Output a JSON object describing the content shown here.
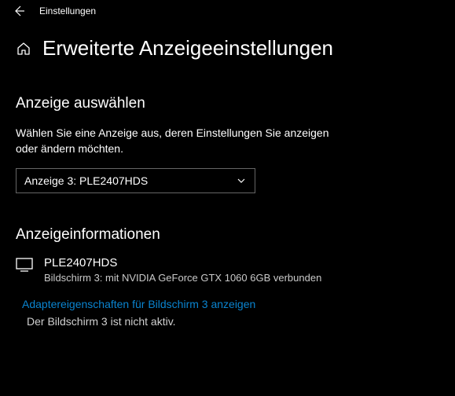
{
  "topbar": {
    "settings": "Einstellungen"
  },
  "page": {
    "title": "Erweiterte Anzeigeeinstellungen"
  },
  "select_display": {
    "heading": "Anzeige auswählen",
    "description": "Wählen Sie eine Anzeige aus, deren Einstellungen Sie anzeigen oder ändern möchten.",
    "selected": "Anzeige 3: PLE2407HDS"
  },
  "display_info": {
    "heading": "Anzeigeinformationen",
    "device_name": "PLE2407HDS",
    "device_detail": "Bildschirm 3: mit NVIDIA GeForce GTX 1060 6GB verbunden",
    "adapter_link": "Adaptereigenschaften für Bildschirm 3 anzeigen",
    "status": "Der Bildschirm 3 ist nicht aktiv."
  }
}
